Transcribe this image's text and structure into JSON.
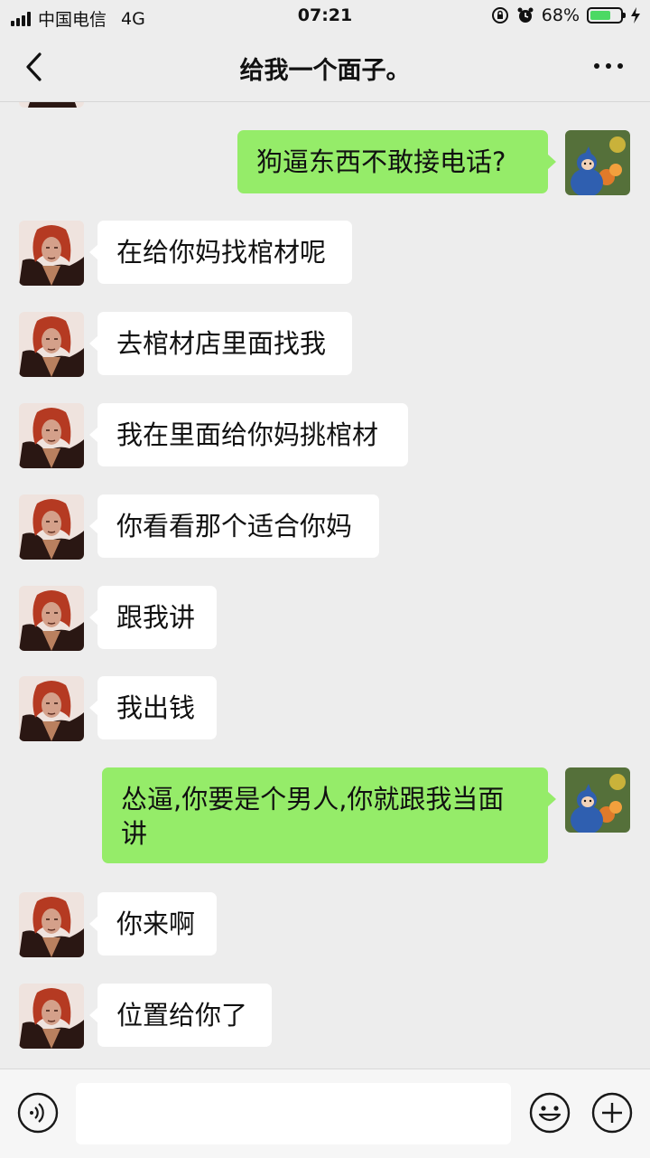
{
  "status": {
    "carrier": "中国电信",
    "network": "4G",
    "time": "07:21",
    "battery": "68%",
    "battery_level": 0.68
  },
  "nav": {
    "title": "给我一个面子。",
    "back_icon": "chevron-left-icon",
    "more_icon": "more-dots-icon"
  },
  "messages": [
    {
      "from": "me",
      "text": "狗逼东西不敢接电话?"
    },
    {
      "from": "other",
      "text": "在给你妈找棺材呢"
    },
    {
      "from": "other",
      "text": "去棺材店里面找我"
    },
    {
      "from": "other",
      "text": "我在里面给你妈挑棺材"
    },
    {
      "from": "other",
      "text": "你看看那个适合你妈"
    },
    {
      "from": "other",
      "text": "跟我讲"
    },
    {
      "from": "other",
      "text": "我出钱"
    },
    {
      "from": "me",
      "text": "怂逼,你要是个男人,你就跟我当面讲"
    },
    {
      "from": "other",
      "text": "你来啊"
    },
    {
      "from": "other",
      "text": "位置给你了"
    }
  ],
  "input": {
    "value": "",
    "placeholder": ""
  },
  "icons": {
    "voice": "voice-icon",
    "emoji": "emoji-icon",
    "add": "plus-icon"
  },
  "colors": {
    "background": "#ededed",
    "my_bubble": "#95ec69",
    "their_bubble": "#ffffff",
    "battery_fill": "#4cd964"
  }
}
